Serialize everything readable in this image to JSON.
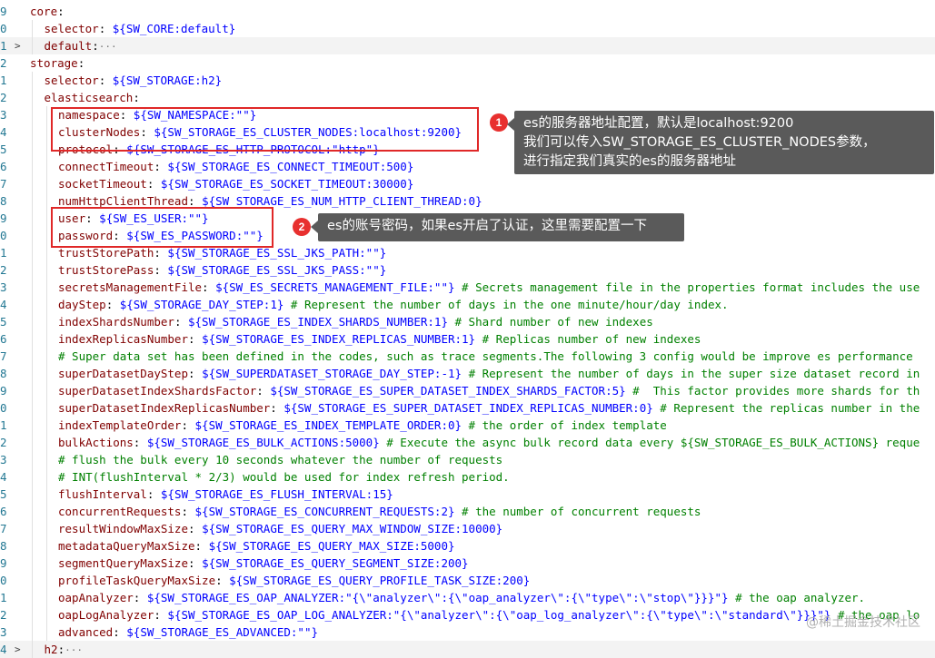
{
  "editor": {
    "lines": [
      {
        "ln": "9",
        "indent": 0,
        "fold": "",
        "tokens": [
          [
            "k",
            "core"
          ],
          [
            "p",
            ":"
          ]
        ]
      },
      {
        "ln": "0",
        "indent": 1,
        "fold": "",
        "tokens": [
          [
            "k",
            "selector"
          ],
          [
            "p",
            ": "
          ],
          [
            "v",
            "${SW_CORE:default}"
          ]
        ]
      },
      {
        "ln": "1",
        "indent": 1,
        "fold": ">",
        "highlight": true,
        "tokens": [
          [
            "k",
            "default"
          ],
          [
            "p",
            ":"
          ],
          [
            "ell",
            "···"
          ]
        ]
      },
      {
        "ln": "2",
        "indent": 0,
        "fold": "",
        "tokens": [
          [
            "k",
            "storage"
          ],
          [
            "p",
            ":"
          ]
        ]
      },
      {
        "ln": "1",
        "indent": 1,
        "fold": "",
        "tokens": [
          [
            "k",
            "selector"
          ],
          [
            "p",
            ": "
          ],
          [
            "v",
            "${SW_STORAGE:h2}"
          ]
        ]
      },
      {
        "ln": "2",
        "indent": 1,
        "fold": "",
        "tokens": [
          [
            "k",
            "elasticsearch"
          ],
          [
            "p",
            ":"
          ]
        ]
      },
      {
        "ln": "3",
        "indent": 2,
        "fold": "",
        "tokens": [
          [
            "k",
            "namespace"
          ],
          [
            "p",
            ": "
          ],
          [
            "v",
            "${SW_NAMESPACE:\"\"}"
          ]
        ]
      },
      {
        "ln": "4",
        "indent": 2,
        "fold": "",
        "tokens": [
          [
            "k",
            "clusterNodes"
          ],
          [
            "p",
            ": "
          ],
          [
            "v",
            "${SW_STORAGE_ES_CLUSTER_NODES:localhost:9200}"
          ]
        ]
      },
      {
        "ln": "5",
        "indent": 2,
        "fold": "",
        "tokens": [
          [
            "k",
            "protocol"
          ],
          [
            "p",
            ": "
          ],
          [
            "v",
            "${SW_STORAGE_ES_HTTP_PROTOCOL:\"http\"}"
          ]
        ]
      },
      {
        "ln": "6",
        "indent": 2,
        "fold": "",
        "tokens": [
          [
            "k",
            "connectTimeout"
          ],
          [
            "p",
            ": "
          ],
          [
            "v",
            "${SW_STORAGE_ES_CONNECT_TIMEOUT:500}"
          ]
        ]
      },
      {
        "ln": "7",
        "indent": 2,
        "fold": "",
        "tokens": [
          [
            "k",
            "socketTimeout"
          ],
          [
            "p",
            ": "
          ],
          [
            "v",
            "${SW_STORAGE_ES_SOCKET_TIMEOUT:30000}"
          ]
        ]
      },
      {
        "ln": "8",
        "indent": 2,
        "fold": "",
        "tokens": [
          [
            "k",
            "numHttpClientThread"
          ],
          [
            "p",
            ": "
          ],
          [
            "v",
            "${SW_STORAGE_ES_NUM_HTTP_CLIENT_THREAD:0}"
          ]
        ]
      },
      {
        "ln": "9",
        "indent": 2,
        "fold": "",
        "tokens": [
          [
            "k",
            "user"
          ],
          [
            "p",
            ": "
          ],
          [
            "v",
            "${SW_ES_USER:\"\"}"
          ]
        ]
      },
      {
        "ln": "0",
        "indent": 2,
        "fold": "",
        "tokens": [
          [
            "k",
            "password"
          ],
          [
            "p",
            ": "
          ],
          [
            "v",
            "${SW_ES_PASSWORD:\"\"}"
          ]
        ]
      },
      {
        "ln": "1",
        "indent": 2,
        "fold": "",
        "tokens": [
          [
            "k",
            "trustStorePath"
          ],
          [
            "p",
            ": "
          ],
          [
            "v",
            "${SW_STORAGE_ES_SSL_JKS_PATH:\"\"}"
          ]
        ]
      },
      {
        "ln": "2",
        "indent": 2,
        "fold": "",
        "tokens": [
          [
            "k",
            "trustStorePass"
          ],
          [
            "p",
            ": "
          ],
          [
            "v",
            "${SW_STORAGE_ES_SSL_JKS_PASS:\"\"}"
          ]
        ]
      },
      {
        "ln": "3",
        "indent": 2,
        "fold": "",
        "tokens": [
          [
            "k",
            "secretsManagementFile"
          ],
          [
            "p",
            ": "
          ],
          [
            "v",
            "${SW_ES_SECRETS_MANAGEMENT_FILE:\"\"}"
          ],
          [
            "c",
            " # Secrets management file in the properties format includes the use"
          ]
        ]
      },
      {
        "ln": "4",
        "indent": 2,
        "fold": "",
        "tokens": [
          [
            "k",
            "dayStep"
          ],
          [
            "p",
            ": "
          ],
          [
            "v",
            "${SW_STORAGE_DAY_STEP:1}"
          ],
          [
            "c",
            " # Represent the number of days in the one minute/hour/day index."
          ]
        ]
      },
      {
        "ln": "5",
        "indent": 2,
        "fold": "",
        "tokens": [
          [
            "k",
            "indexShardsNumber"
          ],
          [
            "p",
            ": "
          ],
          [
            "v",
            "${SW_STORAGE_ES_INDEX_SHARDS_NUMBER:1}"
          ],
          [
            "c",
            " # Shard number of new indexes"
          ]
        ]
      },
      {
        "ln": "6",
        "indent": 2,
        "fold": "",
        "tokens": [
          [
            "k",
            "indexReplicasNumber"
          ],
          [
            "p",
            ": "
          ],
          [
            "v",
            "${SW_STORAGE_ES_INDEX_REPLICAS_NUMBER:1}"
          ],
          [
            "c",
            " # Replicas number of new indexes"
          ]
        ]
      },
      {
        "ln": "7",
        "indent": 2,
        "fold": "",
        "tokens": [
          [
            "c",
            "# Super data set has been defined in the codes, such as trace segments.The following 3 config would be improve es performance"
          ]
        ]
      },
      {
        "ln": "8",
        "indent": 2,
        "fold": "",
        "tokens": [
          [
            "k",
            "superDatasetDayStep"
          ],
          [
            "p",
            ": "
          ],
          [
            "v",
            "${SW_SUPERDATASET_STORAGE_DAY_STEP:-1}"
          ],
          [
            "c",
            " # Represent the number of days in the super size dataset record in"
          ]
        ]
      },
      {
        "ln": "9",
        "indent": 2,
        "fold": "",
        "tokens": [
          [
            "k",
            "superDatasetIndexShardsFactor"
          ],
          [
            "p",
            ": "
          ],
          [
            "v",
            "${SW_STORAGE_ES_SUPER_DATASET_INDEX_SHARDS_FACTOR:5}"
          ],
          [
            "c",
            " #  This factor provides more shards for th"
          ]
        ]
      },
      {
        "ln": "0",
        "indent": 2,
        "fold": "",
        "tokens": [
          [
            "k",
            "superDatasetIndexReplicasNumber"
          ],
          [
            "p",
            ": "
          ],
          [
            "v",
            "${SW_STORAGE_ES_SUPER_DATASET_INDEX_REPLICAS_NUMBER:0}"
          ],
          [
            "c",
            " # Represent the replicas number in the"
          ]
        ]
      },
      {
        "ln": "1",
        "indent": 2,
        "fold": "",
        "tokens": [
          [
            "k",
            "indexTemplateOrder"
          ],
          [
            "p",
            ": "
          ],
          [
            "v",
            "${SW_STORAGE_ES_INDEX_TEMPLATE_ORDER:0}"
          ],
          [
            "c",
            " # the order of index template"
          ]
        ]
      },
      {
        "ln": "2",
        "indent": 2,
        "fold": "",
        "tokens": [
          [
            "k",
            "bulkActions"
          ],
          [
            "p",
            ": "
          ],
          [
            "v",
            "${SW_STORAGE_ES_BULK_ACTIONS:5000}"
          ],
          [
            "c",
            " # Execute the async bulk record data every ${SW_STORAGE_ES_BULK_ACTIONS} reque"
          ]
        ]
      },
      {
        "ln": "3",
        "indent": 2,
        "fold": "",
        "tokens": [
          [
            "c",
            "# flush the bulk every 10 seconds whatever the number of requests"
          ]
        ]
      },
      {
        "ln": "4",
        "indent": 2,
        "fold": "",
        "tokens": [
          [
            "c",
            "# INT(flushInterval * 2/3) would be used for index refresh period."
          ]
        ]
      },
      {
        "ln": "5",
        "indent": 2,
        "fold": "",
        "tokens": [
          [
            "k",
            "flushInterval"
          ],
          [
            "p",
            ": "
          ],
          [
            "v",
            "${SW_STORAGE_ES_FLUSH_INTERVAL:15}"
          ]
        ]
      },
      {
        "ln": "6",
        "indent": 2,
        "fold": "",
        "tokens": [
          [
            "k",
            "concurrentRequests"
          ],
          [
            "p",
            ": "
          ],
          [
            "v",
            "${SW_STORAGE_ES_CONCURRENT_REQUESTS:2}"
          ],
          [
            "c",
            " # the number of concurrent requests"
          ]
        ]
      },
      {
        "ln": "7",
        "indent": 2,
        "fold": "",
        "tokens": [
          [
            "k",
            "resultWindowMaxSize"
          ],
          [
            "p",
            ": "
          ],
          [
            "v",
            "${SW_STORAGE_ES_QUERY_MAX_WINDOW_SIZE:10000}"
          ]
        ]
      },
      {
        "ln": "8",
        "indent": 2,
        "fold": "",
        "tokens": [
          [
            "k",
            "metadataQueryMaxSize"
          ],
          [
            "p",
            ": "
          ],
          [
            "v",
            "${SW_STORAGE_ES_QUERY_MAX_SIZE:5000}"
          ]
        ]
      },
      {
        "ln": "9",
        "indent": 2,
        "fold": "",
        "tokens": [
          [
            "k",
            "segmentQueryMaxSize"
          ],
          [
            "p",
            ": "
          ],
          [
            "v",
            "${SW_STORAGE_ES_QUERY_SEGMENT_SIZE:200}"
          ]
        ]
      },
      {
        "ln": "0",
        "indent": 2,
        "fold": "",
        "tokens": [
          [
            "k",
            "profileTaskQueryMaxSize"
          ],
          [
            "p",
            ": "
          ],
          [
            "v",
            "${SW_STORAGE_ES_QUERY_PROFILE_TASK_SIZE:200}"
          ]
        ]
      },
      {
        "ln": "1",
        "indent": 2,
        "fold": "",
        "tokens": [
          [
            "k",
            "oapAnalyzer"
          ],
          [
            "p",
            ": "
          ],
          [
            "v",
            "${SW_STORAGE_ES_OAP_ANALYZER:\"{\\\"analyzer\\\":{\\\"oap_analyzer\\\":{\\\"type\\\":\\\"stop\\\"}}}\"}"
          ],
          [
            "c",
            " # the oap analyzer."
          ]
        ]
      },
      {
        "ln": "2",
        "indent": 2,
        "fold": "",
        "tokens": [
          [
            "k",
            "oapLogAnalyzer"
          ],
          [
            "p",
            ": "
          ],
          [
            "v",
            "${SW_STORAGE_ES_OAP_LOG_ANALYZER:\"{\\\"analyzer\\\":{\\\"oap_log_analyzer\\\":{\\\"type\\\":\\\"standard\\\"}}}\"}"
          ],
          [
            "c",
            " # the oap lo"
          ]
        ]
      },
      {
        "ln": "3",
        "indent": 2,
        "fold": "",
        "tokens": [
          [
            "k",
            "advanced"
          ],
          [
            "p",
            ": "
          ],
          [
            "v",
            "${SW_STORAGE_ES_ADVANCED:\"\"}"
          ]
        ]
      },
      {
        "ln": "4",
        "indent": 1,
        "fold": ">",
        "highlight": true,
        "tokens": [
          [
            "k",
            "h2"
          ],
          [
            "p",
            ":"
          ],
          [
            "ell",
            "···"
          ]
        ]
      }
    ]
  },
  "annotations": [
    {
      "number": "1",
      "lines": [
        "es的服务器地址配置，默认是localhost:9200",
        "我们可以传入SW_STORAGE_ES_CLUSTER_NODES参数，",
        "进行指定我们真实的es的服务器地址"
      ]
    },
    {
      "number": "2",
      "lines": [
        "es的账号密码，如果es开启了认证，这里需要配置一下"
      ]
    }
  ],
  "colors": {
    "key": "#800000",
    "value": "#0000ff",
    "comment": "#008000",
    "highlight_box": "#e02828",
    "badge": "#e8302f",
    "callout_bg": "#5a5a5a"
  },
  "watermark": "@稀土掘金技术社区"
}
